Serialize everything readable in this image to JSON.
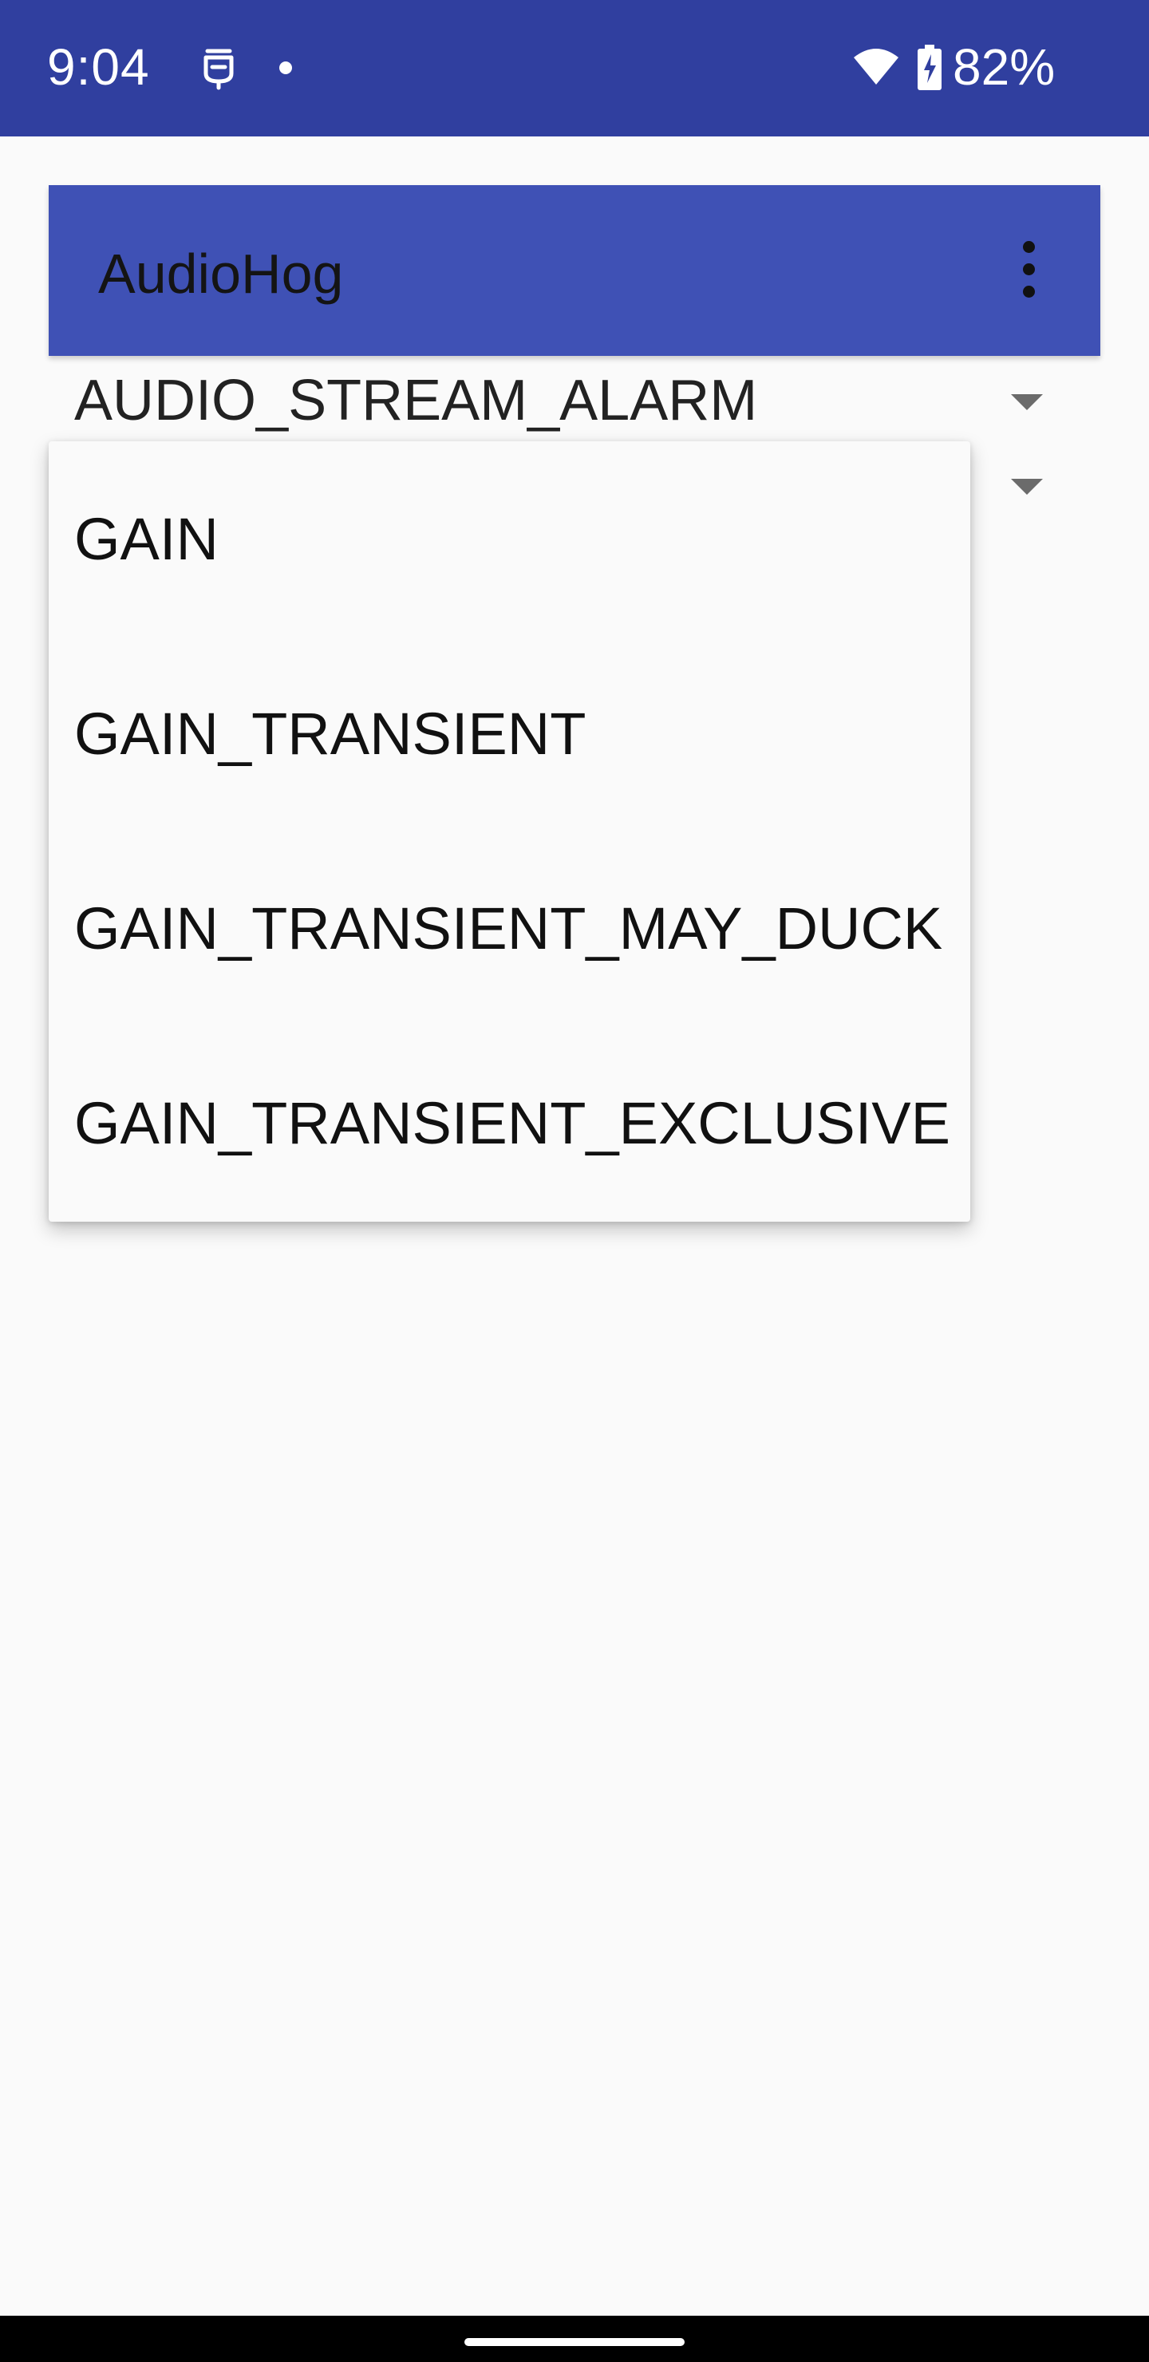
{
  "status_bar": {
    "time": "9:04",
    "battery": "82%",
    "icons": [
      "notification-icon",
      "dot-icon",
      "wifi-icon",
      "battery-charging-icon"
    ],
    "background_color": "#303f9f"
  },
  "app_bar": {
    "title": "AudioHog",
    "menu_icon": "overflow-menu-icon",
    "background_color": "#3f51b5"
  },
  "spinners": {
    "stream": {
      "selected": "AUDIO_STREAM_ALARM"
    },
    "focus": {
      "selected": ""
    }
  },
  "dropdown": {
    "options": [
      "GAIN",
      "GAIN_TRANSIENT",
      "GAIN_TRANSIENT_MAY_DUCK",
      "GAIN_TRANSIENT_EXCLUSIVE"
    ]
  }
}
